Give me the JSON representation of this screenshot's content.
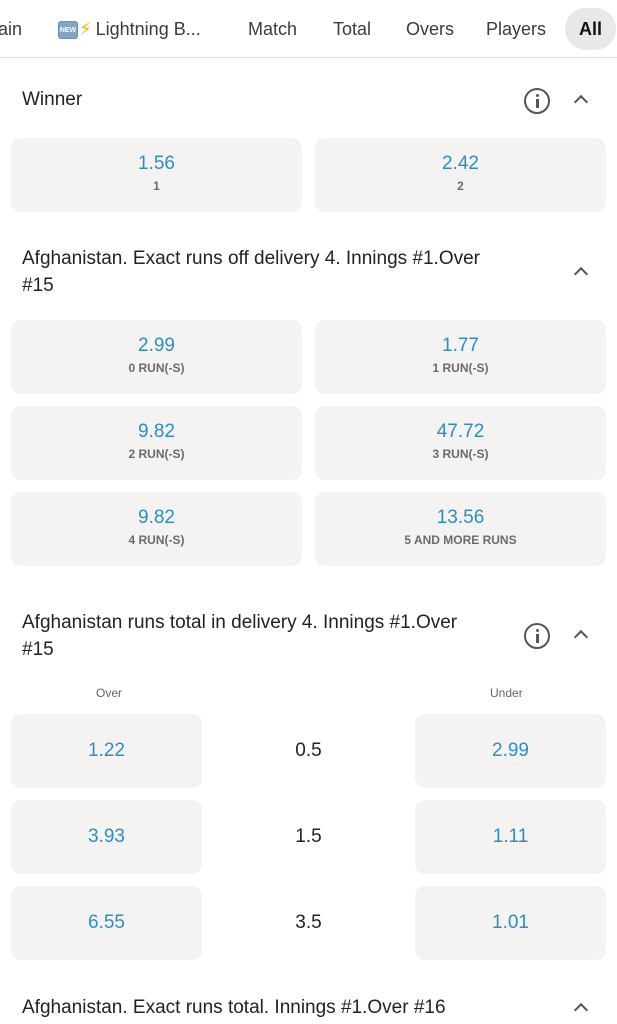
{
  "tabs": [
    {
      "label": "ain",
      "active": false
    },
    {
      "label": "Lightning B...",
      "badge": "NEW",
      "emoji": "⚡",
      "active": false
    },
    {
      "label": "Match",
      "active": false
    },
    {
      "label": "Total",
      "active": false
    },
    {
      "label": "Overs",
      "active": false
    },
    {
      "label": "Players",
      "active": false
    },
    {
      "label": "All",
      "active": true
    }
  ],
  "markets": [
    {
      "title": "Winner",
      "has_info": true,
      "collapse_icon": "chevron-up-icon",
      "outcomes": [
        {
          "odds": "1.56",
          "label": "1"
        },
        {
          "odds": "2.42",
          "label": "2"
        }
      ]
    },
    {
      "title_line1": "Afghanistan. Exact runs off delivery 4. Innings #1.Over",
      "title_line2": "#15",
      "has_info": false,
      "collapse_icon": "chevron-up-icon",
      "outcomes": [
        {
          "odds": "2.99",
          "label": "0 RUN(-S)"
        },
        {
          "odds": "1.77",
          "label": "1 RUN(-S)"
        },
        {
          "odds": "9.82",
          "label": "2 RUN(-S)"
        },
        {
          "odds": "47.72",
          "label": "3 RUN(-S)"
        },
        {
          "odds": "9.82",
          "label": "4 RUN(-S)"
        },
        {
          "odds": "13.56",
          "label": "5 AND MORE RUNS"
        }
      ]
    },
    {
      "title_line1": "Afghanistan runs total in delivery 4. Innings #1.Over",
      "title_line2": "#15",
      "has_info": true,
      "collapse_icon": "chevron-up-icon",
      "over_label": "Over",
      "under_label": "Under",
      "rows": [
        {
          "over": "1.22",
          "line": "0.5",
          "under": "2.99"
        },
        {
          "over": "3.93",
          "line": "1.5",
          "under": "1.11"
        },
        {
          "over": "6.55",
          "line": "3.5",
          "under": "1.01"
        }
      ]
    },
    {
      "title": "Afghanistan. Exact runs total. Innings #1.Over #16",
      "has_info": false,
      "collapse_icon": "chevron-up-icon"
    }
  ]
}
